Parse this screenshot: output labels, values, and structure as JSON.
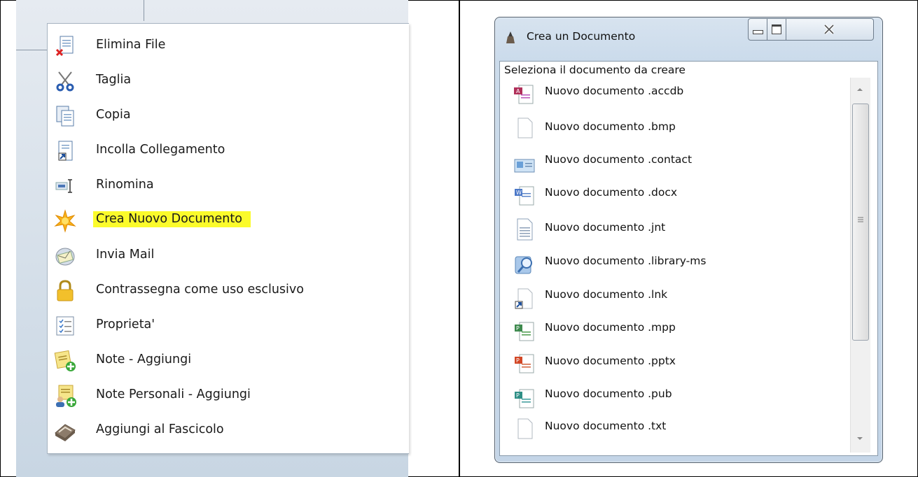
{
  "context_menu": {
    "items": [
      {
        "label": "Elimina File",
        "icon": "delete-file-icon"
      },
      {
        "label": "Taglia",
        "icon": "scissors-icon"
      },
      {
        "label": "Copia",
        "icon": "copy-icon"
      },
      {
        "label": "Incolla Collegamento",
        "icon": "paste-link-icon"
      },
      {
        "label": "Rinomina",
        "icon": "rename-icon"
      },
      {
        "label": "Crea Nuovo Documento",
        "icon": "new-document-star-icon",
        "highlighted": true
      },
      {
        "label": "Invia Mail",
        "icon": "mail-icon"
      },
      {
        "label": "Contrassegna come uso esclusivo",
        "icon": "lock-icon"
      },
      {
        "label": "Proprieta'",
        "icon": "properties-list-icon"
      },
      {
        "label": "Note - Aggiungi",
        "icon": "add-note-icon"
      },
      {
        "label": "Note Personali - Aggiungi",
        "icon": "add-personal-note-icon"
      },
      {
        "label": "Aggiungi al Fascicolo",
        "icon": "add-to-folder-icon"
      }
    ],
    "highlight_color": "#fbfb2b"
  },
  "dialog": {
    "title": "Crea un Documento",
    "prompt": "Seleziona il documento da creare",
    "items": [
      {
        "label": "Nuovo documento .accdb",
        "icon": "access-file-icon"
      },
      {
        "label": "Nuovo documento .bmp",
        "icon": "blank-file-icon"
      },
      {
        "label": "Nuovo documento .contact",
        "icon": "contact-card-icon"
      },
      {
        "label": "Nuovo documento .docx",
        "icon": "word-file-icon"
      },
      {
        "label": "Nuovo documento .jnt",
        "icon": "journal-file-icon"
      },
      {
        "label": "Nuovo documento .library-ms",
        "icon": "library-icon"
      },
      {
        "label": "Nuovo documento .lnk",
        "icon": "shortcut-file-icon"
      },
      {
        "label": "Nuovo documento .mpp",
        "icon": "project-file-icon"
      },
      {
        "label": "Nuovo documento .pptx",
        "icon": "powerpoint-file-icon"
      },
      {
        "label": "Nuovo documento .pub",
        "icon": "publisher-file-icon"
      },
      {
        "label": "Nuovo documento .txt",
        "icon": "text-file-icon"
      }
    ]
  }
}
